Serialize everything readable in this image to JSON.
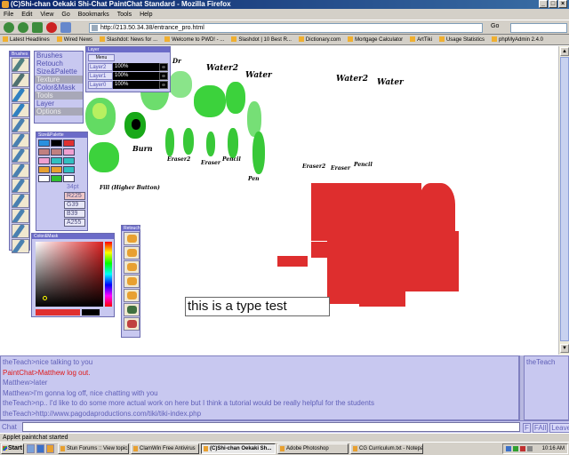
{
  "window": {
    "title": "(C)Shi-chan Oekaki Shi-Chat PaintChat Standard - Mozilla Firefox",
    "controls": [
      "_",
      "□",
      "×"
    ]
  },
  "menubar": [
    "File",
    "Edit",
    "View",
    "Go",
    "Bookmarks",
    "Tools",
    "Help"
  ],
  "navigation": {
    "url": "http://213.50.34.38/entrance_pro.html",
    "go_label": "Go"
  },
  "bookmarks": [
    "Latest Headlines",
    "Wired News",
    "Slashdot: News for ...",
    "Welcome to PWD! - ...",
    "Slashdot | 10 Best R...",
    "Dictionary.com",
    "Mortgage Calculator",
    "ArtTiki",
    "Usage Statistics",
    "phpMyAdmin 2.4.0"
  ],
  "oekaki": {
    "brushes_title": "Brushes",
    "menu_panel": {
      "items": [
        "Brushes",
        "Retouch",
        "Size&Palette",
        "Texture",
        "Color&Mask",
        "Tools",
        "Layer",
        "Options"
      ],
      "selected": [
        3,
        5,
        7
      ]
    },
    "layer_panel": {
      "title": "Layer",
      "menu_label": "Menu",
      "layers": [
        {
          "name": "Layer2",
          "opacity": "100%"
        },
        {
          "name": "Layer1",
          "opacity": "100%"
        },
        {
          "name": "Layer0",
          "opacity": "100%"
        }
      ]
    },
    "size_panel": {
      "title": "Size&Palette",
      "size": "34pt",
      "r": "R225",
      "g": "G39",
      "b": "B39",
      "a": "A255",
      "swatches": [
        "#2a90e0",
        "#000000",
        "#e03030",
        "#c08080",
        "#c08080",
        "#f0a0d0",
        "#f0a0d0",
        "#30c0c0",
        "#30c0c0",
        "#e8a030",
        "#e8a030",
        "#30c0c0",
        "#ffffff",
        "#30c030",
        "#ffffff"
      ]
    },
    "color_panel": {
      "title": "Color&Mask"
    },
    "retouch_panel": {
      "title": "Retouch"
    },
    "canvas_labels": [
      "Water2",
      "Water",
      "Water2",
      "Water",
      "Burn",
      "Eraser2",
      "Eraser",
      "Pencil",
      "Pen",
      "Eraser2",
      "Eraser",
      "Pencil",
      "Fill (Higher Button)",
      "Dr"
    ],
    "type_test": "this is a type test"
  },
  "chat": {
    "lines": [
      {
        "text": "theTeach>nice talking to you",
        "system": false
      },
      {
        "text": "PaintChat>Matthew log out.",
        "system": true
      },
      {
        "text": "Matthew>later",
        "system": false
      },
      {
        "text": "Matthew>I'm gonna log off, nice chatting with you",
        "system": false
      },
      {
        "text": "theTeach>np.. I'd like to do some more actual work on here but I think a tutorial would be really helpful for the students",
        "system": false
      },
      {
        "text": "theTeach>http://www.pagodaproductions.com/tiki/tiki-index.php",
        "system": false
      }
    ],
    "users": [
      "theTeach"
    ],
    "input_label": "Chat",
    "buttons": [
      "F",
      "FAll",
      "Leave"
    ]
  },
  "status": "Applet paintchat started",
  "taskbar": {
    "start": "Start",
    "tasks": [
      {
        "label": "Stun Forums :: View topic...",
        "active": false
      },
      {
        "label": "ClamWin Free Antivirus",
        "active": false
      },
      {
        "label": "(C)Shi-chan Oekaki Sh...",
        "active": true
      },
      {
        "label": "Adobe Photoshop",
        "active": false
      },
      {
        "label": "CG Curriculum.txt - Notepad",
        "active": false
      }
    ],
    "clock": "10:16 AM"
  },
  "colors": {
    "accent": "#6b6bc8",
    "panel_bg": "#c8c8f0",
    "paint_green": "#3cd23c",
    "paint_red": "#de2e2e"
  }
}
